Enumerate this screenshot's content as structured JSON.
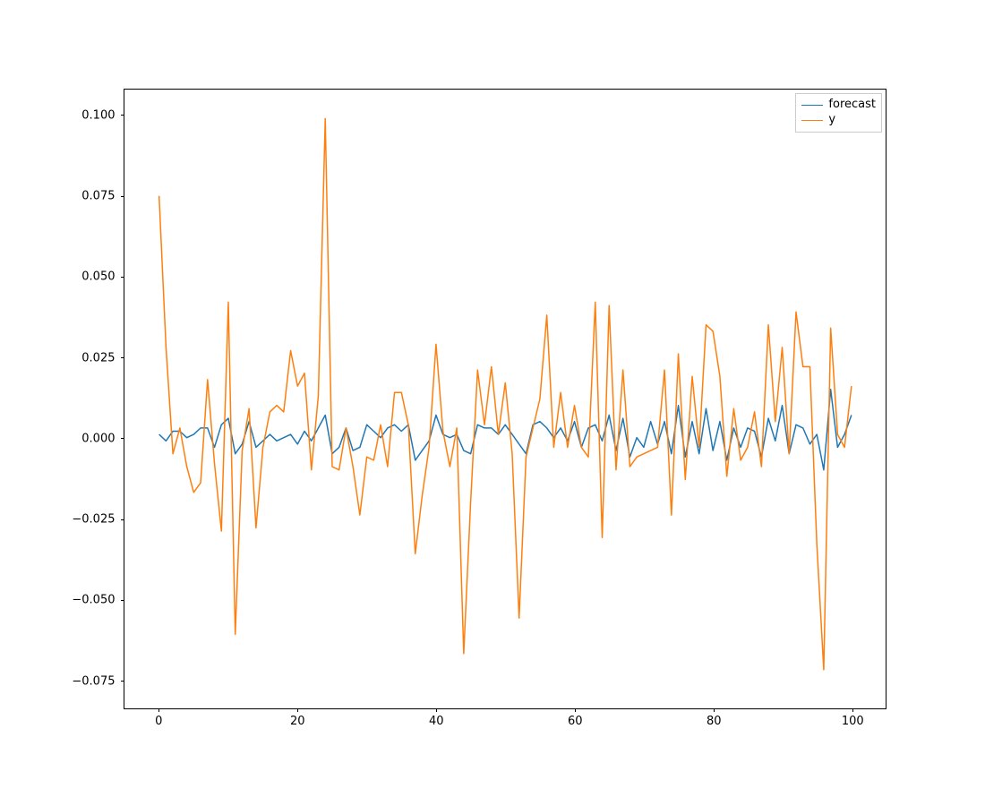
{
  "chart_data": {
    "type": "line",
    "x": [
      0,
      1,
      2,
      3,
      4,
      5,
      6,
      7,
      8,
      9,
      10,
      11,
      12,
      13,
      14,
      15,
      16,
      17,
      18,
      19,
      20,
      21,
      22,
      23,
      24,
      25,
      26,
      27,
      28,
      29,
      30,
      31,
      32,
      33,
      34,
      35,
      36,
      37,
      38,
      39,
      40,
      41,
      42,
      43,
      44,
      45,
      46,
      47,
      48,
      49,
      50,
      51,
      52,
      53,
      54,
      55,
      56,
      57,
      58,
      59,
      60,
      61,
      62,
      63,
      64,
      65,
      66,
      67,
      68,
      69,
      70,
      71,
      72,
      73,
      74,
      75,
      76,
      77,
      78,
      79,
      80,
      81,
      82,
      83,
      84,
      85,
      86,
      87,
      88,
      89,
      90,
      91,
      92,
      93,
      94,
      95,
      96,
      97,
      98,
      99,
      100
    ],
    "series": [
      {
        "name": "forecast",
        "color": "#1f77b4",
        "values": [
          0.001,
          -0.001,
          0.002,
          0.002,
          0.0,
          0.001,
          0.003,
          0.003,
          -0.003,
          0.004,
          0.006,
          -0.005,
          -0.002,
          0.005,
          -0.003,
          -0.001,
          0.001,
          -0.001,
          0.0,
          0.001,
          -0.002,
          0.002,
          -0.001,
          0.003,
          0.007,
          -0.005,
          -0.003,
          0.003,
          -0.004,
          -0.003,
          0.004,
          0.002,
          0.0,
          0.003,
          0.004,
          0.002,
          0.004,
          -0.007,
          -0.004,
          -0.001,
          0.007,
          0.001,
          0.0,
          0.001,
          -0.004,
          -0.005,
          0.004,
          0.003,
          0.003,
          0.001,
          0.004,
          0.001,
          -0.002,
          -0.005,
          0.004,
          0.005,
          0.003,
          0.0,
          0.003,
          -0.001,
          0.005,
          -0.003,
          0.003,
          0.004,
          -0.001,
          0.007,
          -0.004,
          0.006,
          -0.006,
          0.0,
          -0.003,
          0.005,
          -0.002,
          0.005,
          -0.005,
          0.01,
          -0.006,
          0.005,
          -0.005,
          0.009,
          -0.004,
          0.005,
          -0.007,
          0.003,
          -0.003,
          0.003,
          0.002,
          -0.006,
          0.006,
          -0.001,
          0.01,
          -0.005,
          0.004,
          0.003,
          -0.002,
          0.001,
          -0.01,
          0.015,
          -0.003,
          0.001,
          0.007
        ]
      },
      {
        "name": "y",
        "color": "#ff7f0e",
        "values": [
          0.075,
          0.028,
          -0.005,
          0.003,
          -0.009,
          -0.017,
          -0.014,
          0.018,
          -0.008,
          -0.029,
          0.042,
          -0.061,
          -0.004,
          0.009,
          -0.028,
          -0.003,
          0.008,
          0.01,
          0.008,
          0.027,
          0.016,
          0.02,
          -0.01,
          0.013,
          0.099,
          -0.009,
          -0.01,
          0.003,
          -0.009,
          -0.024,
          -0.006,
          -0.007,
          0.004,
          -0.009,
          0.014,
          0.014,
          0.004,
          -0.036,
          -0.018,
          -0.003,
          0.029,
          0.002,
          -0.009,
          0.003,
          -0.067,
          -0.02,
          0.021,
          0.004,
          0.022,
          0.001,
          0.017,
          -0.005,
          -0.056,
          -0.006,
          0.003,
          0.012,
          0.038,
          -0.003,
          0.014,
          -0.003,
          0.01,
          -0.003,
          -0.006,
          0.042,
          -0.031,
          0.041,
          -0.01,
          0.021,
          -0.009,
          -0.006,
          -0.005,
          -0.004,
          -0.003,
          0.021,
          -0.024,
          0.026,
          -0.013,
          0.019,
          -0.003,
          0.035,
          0.033,
          0.019,
          -0.012,
          0.009,
          -0.007,
          -0.003,
          0.008,
          -0.009,
          0.035,
          0.005,
          0.028,
          -0.005,
          0.039,
          0.022,
          0.022,
          -0.033,
          -0.072,
          0.034,
          0.001,
          -0.003,
          0.016
        ]
      }
    ],
    "xlim": [
      -5,
      105
    ],
    "ylim": [
      -0.084,
      0.108
    ],
    "xticks": [
      0,
      20,
      40,
      60,
      80,
      100
    ],
    "yticks": [
      -0.075,
      -0.05,
      -0.025,
      0.0,
      0.025,
      0.05,
      0.075,
      0.1
    ],
    "xtick_labels": [
      "0",
      "20",
      "40",
      "60",
      "80",
      "100"
    ],
    "ytick_labels": [
      "−0.075",
      "−0.050",
      "−0.025",
      "0.000",
      "0.025",
      "0.050",
      "0.075",
      "0.100"
    ],
    "legend": [
      "forecast",
      "y"
    ],
    "title": "",
    "xlabel": "",
    "ylabel": ""
  }
}
